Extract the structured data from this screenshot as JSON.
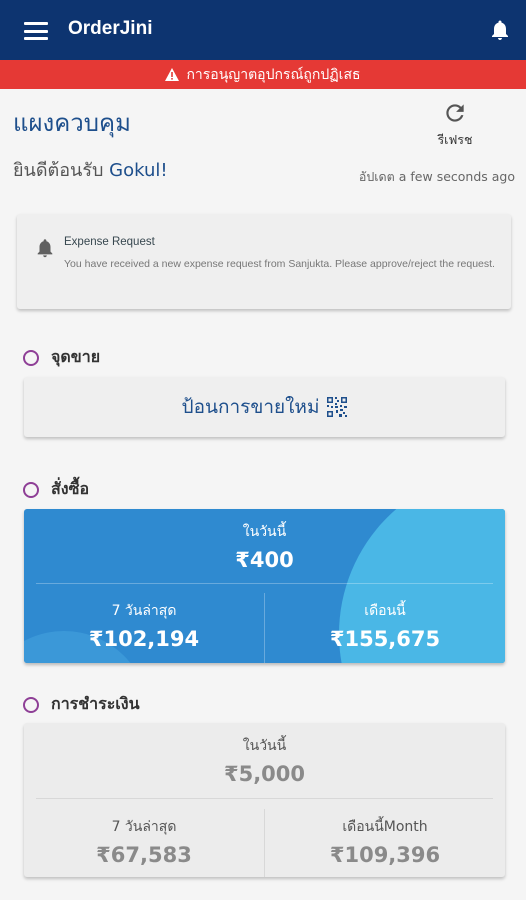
{
  "app": {
    "title": "OrderJini"
  },
  "alert": {
    "text": "การอนุญาตอุปกรณ์ถูกปฏิเสธ",
    "color": "#e53935"
  },
  "header": {
    "title": "แผงควบคุม",
    "refresh_label": "รีเฟรช",
    "welcome_prefix": "ยินดีต้อนรับ ",
    "username": "Gokul!",
    "updated": "อัปเดต a few seconds ago"
  },
  "notification": {
    "title": "Expense Request",
    "body": "You have received a new expense request from Sanjukta. Please approve/reject the request."
  },
  "sections": {
    "pos": {
      "heading": "จุดขาย",
      "button_label": "ป้อนการขายใหม่"
    },
    "orders": {
      "heading": "สั่งซื้อ",
      "today_label": "ในวันนี้",
      "today_value": "₹400",
      "week_label": "7 วันล่าสุด",
      "week_value": "₹102,194",
      "month_label": "เดือนนี้",
      "month_value": "₹155,675"
    },
    "payments": {
      "heading": "การชำระเงิน",
      "today_label": "ในวันนี้",
      "today_value": "₹5,000",
      "week_label": "7 วันล่าสุด",
      "week_value": "₹67,583",
      "month_label": "เดือนนี้Month",
      "month_value": "₹109,396"
    }
  },
  "colors": {
    "navbar": "#0d3470",
    "accent": "#1e4f8c",
    "orders_card": "#2f8ad0",
    "section_ring": "#8e3f96"
  },
  "icons": {
    "menu": "hamburger-icon",
    "notifications": "bell-icon",
    "refresh": "refresh-icon",
    "warning": "warning-icon",
    "qr": "qr-code-icon"
  }
}
